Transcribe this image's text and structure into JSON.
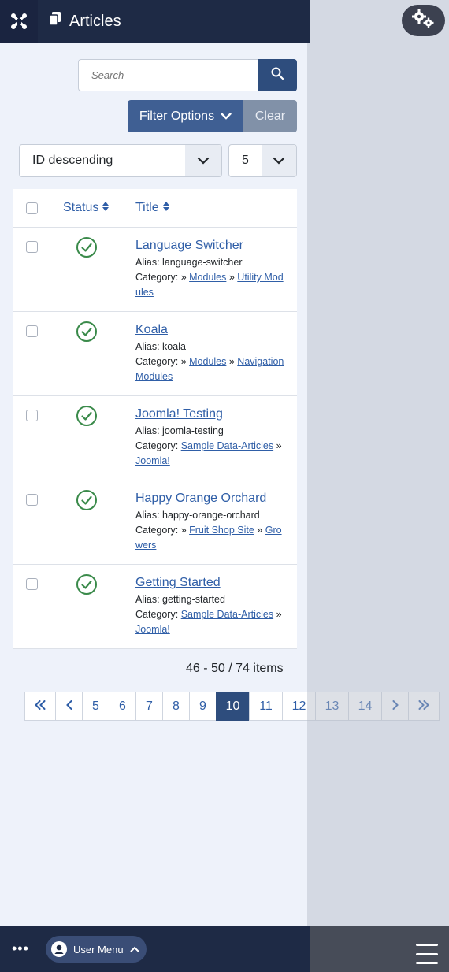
{
  "header": {
    "title": "Articles"
  },
  "search": {
    "placeholder": "Search"
  },
  "filters": {
    "filter_label": "Filter Options",
    "clear_label": "Clear"
  },
  "sort": {
    "ordering": "ID descending",
    "limit": "5"
  },
  "table": {
    "columns": {
      "status": "Status",
      "title": "Title"
    },
    "rows": [
      {
        "title": "Language Switcher",
        "alias": "Alias: language-switcher",
        "category_prefix": "Category:",
        "category_parts": [
          "»",
          "Modules",
          "»",
          "Utility Modules"
        ]
      },
      {
        "title": "Koala",
        "alias": "Alias: koala",
        "category_prefix": "Category:",
        "category_parts": [
          "»",
          "Modules",
          "»",
          "Navigation Modules"
        ]
      },
      {
        "title": "Joomla! Testing",
        "alias": "Alias: joomla-testing",
        "category_prefix": "Category:",
        "category_parts": [
          "Sample Data-Articles",
          "»",
          "Joomla!"
        ]
      },
      {
        "title": "Happy Orange Orchard",
        "alias": "Alias: happy-orange-orchard",
        "category_prefix": "Category:",
        "category_parts": [
          "»",
          "Fruit Shop Site",
          "»",
          "Growers"
        ]
      },
      {
        "title": "Getting Started",
        "alias": "Alias: getting-started",
        "category_prefix": "Category:",
        "category_parts": [
          "Sample Data-Articles",
          "»",
          "Joomla!"
        ]
      }
    ]
  },
  "pagination": {
    "summary": "46 - 50 / 74 items",
    "first": "«",
    "prev": "‹",
    "pages": [
      "5",
      "6",
      "7",
      "8",
      "9",
      "10",
      "11",
      "12",
      "13",
      "14"
    ],
    "active": "10",
    "next": "›",
    "last": "»"
  },
  "footer": {
    "more": "•••",
    "user_menu": "User Menu"
  },
  "colors": {
    "header_bg": "#1e2a45",
    "primary": "#2e4d7d",
    "link": "#2f5ea7",
    "published": "#3a8a4a"
  }
}
